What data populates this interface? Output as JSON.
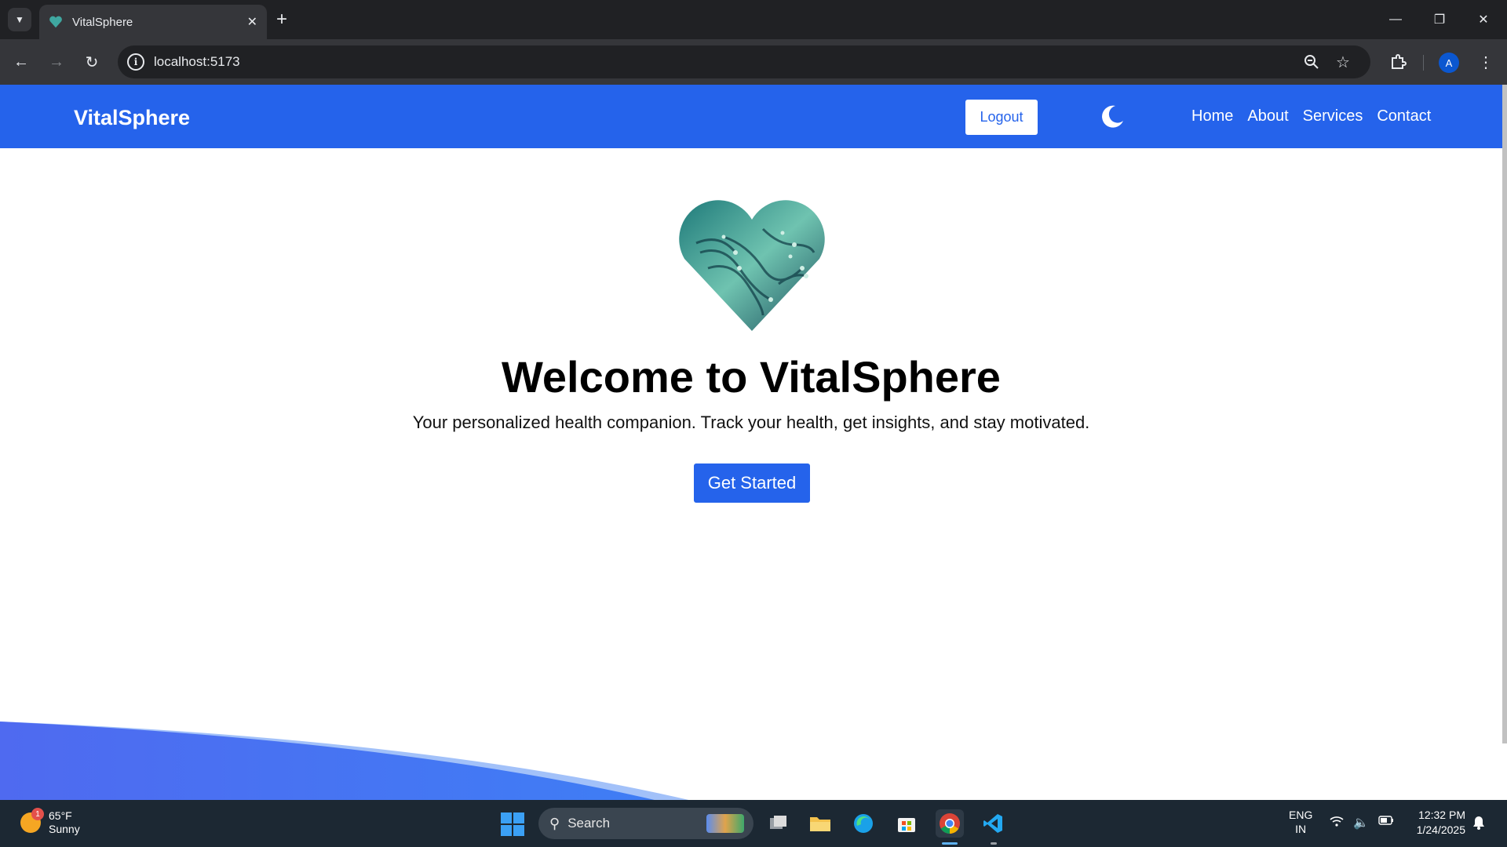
{
  "browser": {
    "tab_title": "VitalSphere",
    "tab_close": "✕",
    "new_tab": "+",
    "url": "localhost:5173",
    "profile_initial": "A",
    "window": {
      "minimize": "—",
      "restore": "❐",
      "close": "✕"
    }
  },
  "app": {
    "brand": "VitalSphere",
    "logout_label": "Logout",
    "nav": [
      "Home",
      "About",
      "Services",
      "Contact"
    ],
    "theme_toggle_icon": "moon-icon",
    "accent": "#2563eb"
  },
  "hero": {
    "title": "Welcome to VitalSphere",
    "subtitle": "Your personalized health companion. Track your health, get insights, and stay motivated.",
    "cta_label": "Get Started"
  },
  "taskbar": {
    "weather_temp": "65°F",
    "weather_desc": "Sunny",
    "weather_badge": "1",
    "search_label": "Search",
    "lang_top": "ENG",
    "lang_bottom": "IN",
    "time": "12:32 PM",
    "date": "1/24/2025"
  }
}
